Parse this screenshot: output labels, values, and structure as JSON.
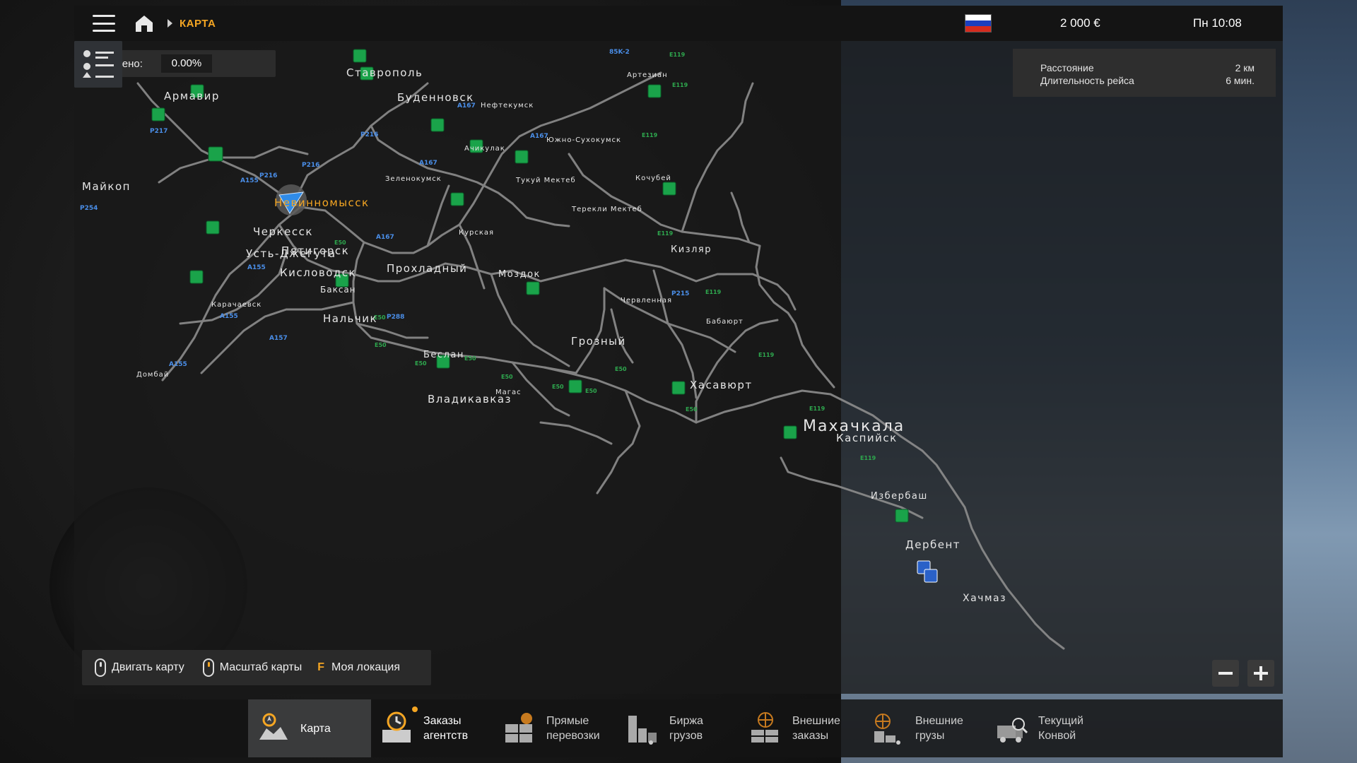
{
  "header": {
    "breadcrumb": "КАРТА",
    "money": "2 000 €",
    "clock": "Пн 10:08",
    "flag_colors": [
      "#ffffff",
      "#1c3fbf",
      "#d52b1e"
    ],
    "accent": "#f5a623"
  },
  "explored": {
    "label": "Изучено:",
    "value": "0.00%"
  },
  "route": {
    "distance_label": "Расстояние",
    "distance_value": "2 км",
    "duration_label": "Длительность рейса",
    "duration_value": "6 мин."
  },
  "map": {
    "cities_major": [
      "Махачкала"
    ],
    "cities": [
      "Ставрополь",
      "Буденновск",
      "Армавир",
      "Майкоп",
      "Невинномысск",
      "Черкесск",
      "Пятигорск",
      "Усть-Джегута",
      "Кисловодск",
      "Прохладный",
      "Нальчик",
      "Моздок",
      "Грозный",
      "Беслан",
      "Владикавказ",
      "Хасавюрт",
      "Кизляр",
      "Каспийск",
      "Избербаш",
      "Дербент",
      "Хачмаз"
    ],
    "towns": [
      "Нефтекумск",
      "Артезиан",
      "Южно-Сухокумск",
      "Ачикулак",
      "Тукуй Мектеб",
      "Кочубей",
      "Зеленокумск",
      "Терекли Мектеб",
      "Курская",
      "Баксан",
      "Карачаевск",
      "Домбай",
      "Червленная",
      "Бабаюрт",
      "Магас"
    ],
    "road_labels": [
      "P217",
      "P216",
      "P216",
      "P217",
      "A155",
      "P254",
      "A167",
      "A167",
      "A167",
      "A167",
      "A155",
      "A155",
      "A157",
      "A155",
      "P288",
      "P215",
      "85K-2",
      "E119",
      "E119",
      "E119",
      "E119",
      "E119",
      "E119",
      "E119",
      "E119",
      "E50",
      "E50",
      "E50",
      "E50",
      "E50",
      "E50",
      "E50",
      "E50",
      "E50",
      "E50"
    ],
    "player_city": "Невинномысск"
  },
  "controls": {
    "move": "Двигать карту",
    "zoom": "Масштаб карты",
    "key": "F",
    "location": "Моя локация"
  },
  "tabs": [
    {
      "line1": "Карта",
      "line2": "",
      "icon": "map-icon",
      "active": true
    },
    {
      "line1": "Заказы",
      "line2": "агентств",
      "icon": "agency-clock-icon",
      "active": false
    },
    {
      "line1": "Прямые",
      "line2": "перевозки",
      "icon": "direct-cargo-icon",
      "active": false
    },
    {
      "line1": "Биржа",
      "line2": "грузов",
      "icon": "freight-market-icon",
      "active": false
    },
    {
      "line1": "Внешние",
      "line2": "заказы",
      "icon": "external-contracts-icon",
      "active": false
    },
    {
      "line1": "Внешние",
      "line2": "грузы",
      "icon": "external-cargo-icon",
      "active": false
    },
    {
      "line1": "Текущий",
      "line2": "Конвой",
      "icon": "convoy-icon",
      "active": false
    }
  ]
}
